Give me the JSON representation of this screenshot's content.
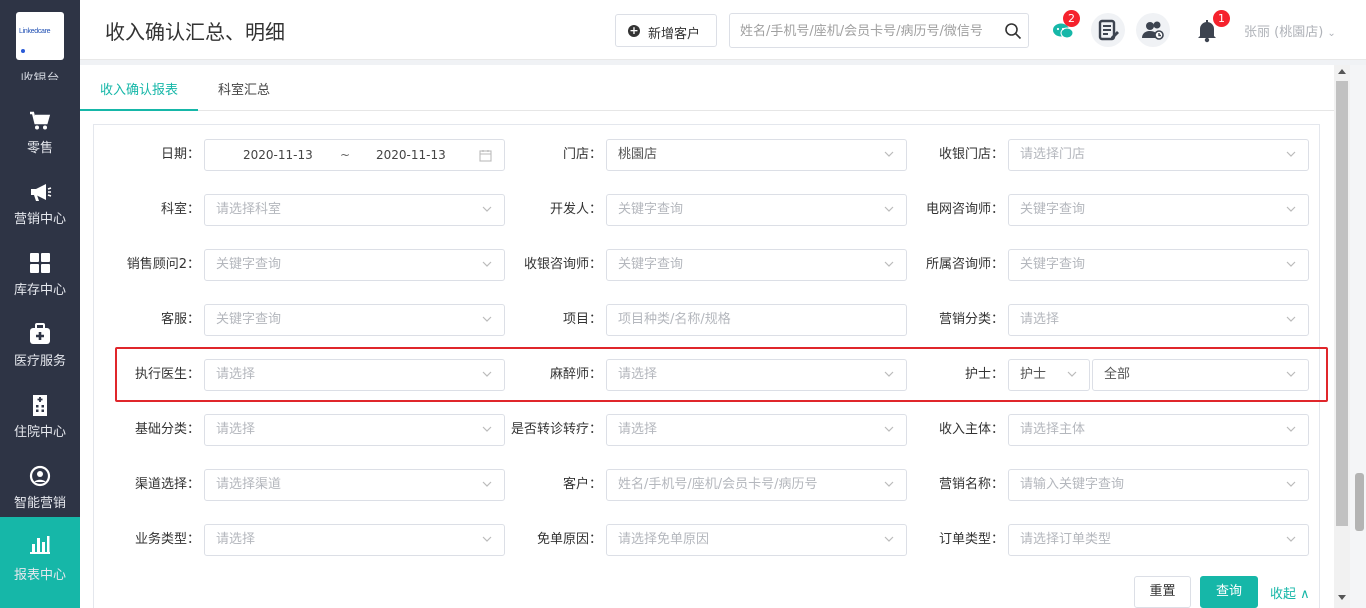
{
  "sidebar": {
    "logo_text": "Linkedcare",
    "partial_label": "收银台",
    "items": [
      {
        "label": "零售",
        "icon": "cart-icon"
      },
      {
        "label": "营销中心",
        "icon": "megaphone-icon"
      },
      {
        "label": "库存中心",
        "icon": "grid-icon"
      },
      {
        "label": "医疗服务",
        "icon": "medical-kit-icon"
      },
      {
        "label": "住院中心",
        "icon": "hospital-building-icon"
      },
      {
        "label": "智能营销",
        "icon": "smart-marketing-icon"
      },
      {
        "label": "报表中心",
        "icon": "bar-chart-icon"
      }
    ],
    "active_index": 6
  },
  "header": {
    "title": "收入确认汇总、明细",
    "add_customer_label": "新增客户",
    "search_placeholder": "姓名/手机号/座机/会员卡号/病历号/微信号",
    "chat_badge": "2",
    "notification_badge": "1",
    "user": "张丽 (桃園店)",
    "accent_color": "#16b7a8"
  },
  "tabs": [
    {
      "label": "收入确认报表",
      "active": true
    },
    {
      "label": "科室汇总",
      "active": false
    }
  ],
  "form": {
    "date_label": "日期：",
    "date_start": "2020-11-13",
    "date_sep": "~",
    "date_end": "2020-11-13",
    "store_label": "门店：",
    "store_value": "桃園店",
    "cashier_store_label": "收银门店：",
    "cashier_store_placeholder": "请选择门店",
    "dept_label": "科室：",
    "dept_placeholder": "请选择科室",
    "developer_label": "开发人：",
    "developer_placeholder": "关键字查询",
    "tele_consultant_label": "电网咨询师：",
    "tele_consultant_placeholder": "关键字查询",
    "sales2_label": "销售顾问2：",
    "sales2_placeholder": "关键字查询",
    "cashier_consultant_label": "收银咨询师：",
    "cashier_consultant_placeholder": "关键字查询",
    "owner_consultant_label": "所属咨询师：",
    "owner_consultant_placeholder": "关键字查询",
    "cs_label": "客服：",
    "cs_placeholder": "关键字查询",
    "item_label": "项目：",
    "item_placeholder": "项目种类/名称/规格",
    "mkt_category_label": "营销分类：",
    "mkt_category_placeholder": "请选择",
    "doctor_label": "执行医生：",
    "doctor_placeholder": "请选择",
    "anesthetist_label": "麻醉师：",
    "anesthetist_placeholder": "请选择",
    "nurse_label": "护士：",
    "nurse_role_value": "护士",
    "nurse_value": "全部",
    "base_category_label": "基础分类：",
    "base_category_placeholder": "请选择",
    "referral_label": "是否转诊转疗：",
    "referral_placeholder": "请选择",
    "income_entity_label": "收入主体：",
    "income_entity_placeholder": "请选择主体",
    "channel_label": "渠道选择：",
    "channel_placeholder": "请选择渠道",
    "customer_label": "客户：",
    "customer_placeholder": "姓名/手机号/座机/会员卡号/病历号",
    "mkt_name_label": "营销名称：",
    "mkt_name_placeholder": "请输入关键字查询",
    "biz_type_label": "业务类型：",
    "biz_type_placeholder": "请选择",
    "waiver_label": "免单原因：",
    "waiver_placeholder": "请选择免单原因",
    "order_type_label": "订单类型：",
    "order_type_placeholder": "请选择订单类型"
  },
  "actions": {
    "reset_label": "重置",
    "query_label": "查询",
    "collapse_label": "收起 ∧"
  }
}
